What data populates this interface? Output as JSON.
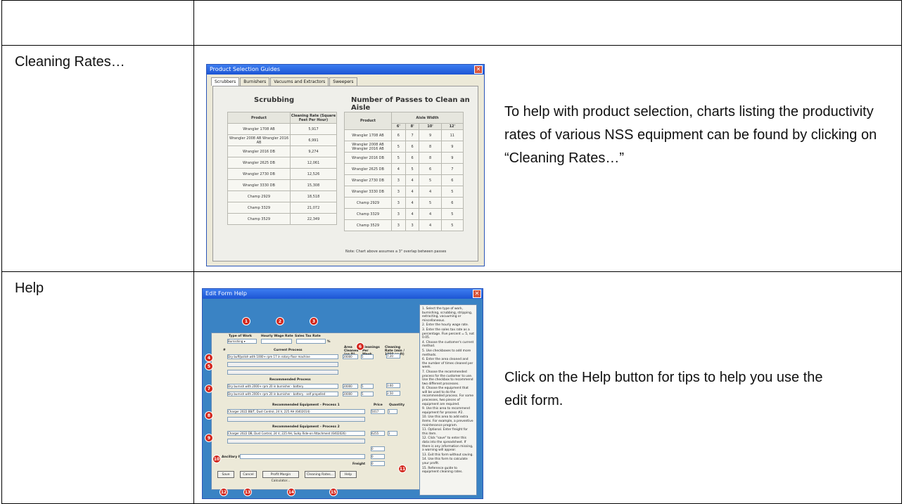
{
  "rows": [
    {
      "label": "",
      "description": ""
    },
    {
      "label": "Cleaning Rates…",
      "description": "To help with product selection, charts listing the productivity rates of various NSS equipment can be found by clicking on “Cleaning Rates…”"
    },
    {
      "label": "Help",
      "description": "Click on the Help button for tips to help you use the edit form."
    }
  ],
  "guide": {
    "title": "Product Selection Guides",
    "tabs": [
      "Scrubbers",
      "Burnishers",
      "Vacuums and Extractors",
      "Sweepers"
    ],
    "active_tab": "Scrubbers",
    "left_heading": "Scrubbing",
    "right_heading": "Number of Passes to Clean an Aisle",
    "left_headers": [
      "Product",
      "Cleaning Rate (Square Feet Per Hour)"
    ],
    "right_headers": [
      "Product",
      "Aisle Width"
    ],
    "widths": [
      "6'",
      "8'",
      "10'",
      "12'"
    ],
    "left_rows": [
      [
        "Wrangler 1708 AB",
        "5,917"
      ],
      [
        "Wrangler 2008 AB Wrangler 2016 AB",
        "6,991"
      ],
      [
        "Wrangler 2016 DB",
        "9,274"
      ],
      [
        "Wrangler 2625 DB",
        "12,061"
      ],
      [
        "Wrangler 2730 DB",
        "12,526"
      ],
      [
        "Wrangler 3330 DB",
        "15,308"
      ],
      [
        "Champ 2929",
        "18,518"
      ],
      [
        "Champ 3329",
        "21,072"
      ],
      [
        "Champ 3529",
        "22,349"
      ]
    ],
    "right_rows": [
      [
        "Wrangler 1708 AB",
        "6",
        "7",
        "9",
        "11"
      ],
      [
        "Wrangler 2008 AB Wrangler 2016 AB",
        "5",
        "6",
        "8",
        "9"
      ],
      [
        "Wrangler 2016 DB",
        "5",
        "6",
        "8",
        "9"
      ],
      [
        "Wrangler 2625 DB",
        "4",
        "5",
        "6",
        "7"
      ],
      [
        "Wrangler 2730 DB",
        "3",
        "4",
        "5",
        "6"
      ],
      [
        "Wrangler 3330 DB",
        "3",
        "4",
        "4",
        "5"
      ],
      [
        "Champ 2929",
        "3",
        "4",
        "5",
        "6"
      ],
      [
        "Champ 3329",
        "3",
        "4",
        "4",
        "5"
      ],
      [
        "Champ 3529",
        "3",
        "3",
        "4",
        "5"
      ]
    ],
    "note": "Note: Chart above assumes a 3\" overlap between passes"
  },
  "help": {
    "title": "Edit Form Help",
    "labels": {
      "type_of_work": "Type of Work",
      "hourly_wage": "Hourly Wage Rate",
      "sales_tax": "Sales Tax Rate",
      "type_value": "Burnishing",
      "wage_value": "12",
      "pct": "%",
      "hash": "#",
      "current_process": "Current Process",
      "area_cleaned": "Area Cleaned (sq ft)",
      "cleanings": "Cleanings Per Week",
      "cleaning_rate": "Cleaning Rate (min / 1000 sq ft)",
      "recommended_process": "Recommended Process",
      "rec_equip_1": "Recommended Equipment - Process 1",
      "rec_equip_2": "Recommended Equipment - Process 2",
      "price": "Price",
      "quantity": "Quantity",
      "ancillary": "Ancillary Item(s)",
      "freight": "Freight"
    },
    "current_row": "Dry buff/polish with 1000+ rpm 17 in rotary floor machine",
    "rec_row1": "Dry burnish with 2000+ rpm 20 in burnisher - battery",
    "rec_row2": "Dry burnish with 2000+ rpm 20 in burnisher - battery - self propelled",
    "equip1": "Charger 2022 BB/T, Dust Control, 24 V, 225 AH (6402014)",
    "equip2": "Charger 2022 DB, Dust Control, 24 V, 225 AH, Sulky Ride-on Attachment (6402026)",
    "area1": "20000",
    "cleanings1": "5",
    "rate1": "7.20",
    "area_r1": "20000",
    "cleanings_r1": "5",
    "rate_r1": "3.60",
    "area_r2": "20000",
    "cleanings_r2": "5",
    "rate_r2": "2.50",
    "price1": "5017",
    "qty1": "1",
    "price2": "6255",
    "qty2": "1",
    "zero": "0",
    "freight_value": "0",
    "buttons": [
      "Save",
      "Cancel",
      "Profit Margin Calculator...",
      "Cleaning Rates...",
      "Help"
    ],
    "tips": [
      "1. Select the type of work, burnishing, scrubbing, stripping, extracting, vacuuming or miscellaneous.",
      "2. Enter the hourly wage rate.",
      "3. Enter the sales tax rate as a percentage. Five percent = 5, not 0.05.",
      "4. Choose the customer's current method.",
      "5. Use checkboxes to add more methods.",
      "6. Enter the area cleaned and the number of times cleaned per week.",
      "7. Choose the recommended process for the customer to use. Use the checkbox to recommend two different processes.",
      "8. Choose the equipment that will be used to do the recommended process. For some processes, two pieces of equipment are required.",
      "9. Use this area to recommend equipment for process #2.",
      "10. Use this area to add extra items. For example, a preventive maintenance program.",
      "11. Optional. Enter freight for this item.",
      "12. Click \"save\" to enter this data into the spreadsheet. If there is any information missing, a warning will appear.",
      "13. Exit this form without saving.",
      "14. Use this form to calculate your profit.",
      "15. Reference guide to equipment cleaning rates."
    ],
    "badges": [
      "1",
      "2",
      "3",
      "4",
      "5",
      "6",
      "7",
      "8",
      "9",
      "10",
      "11",
      "12",
      "13",
      "14",
      "15"
    ]
  }
}
